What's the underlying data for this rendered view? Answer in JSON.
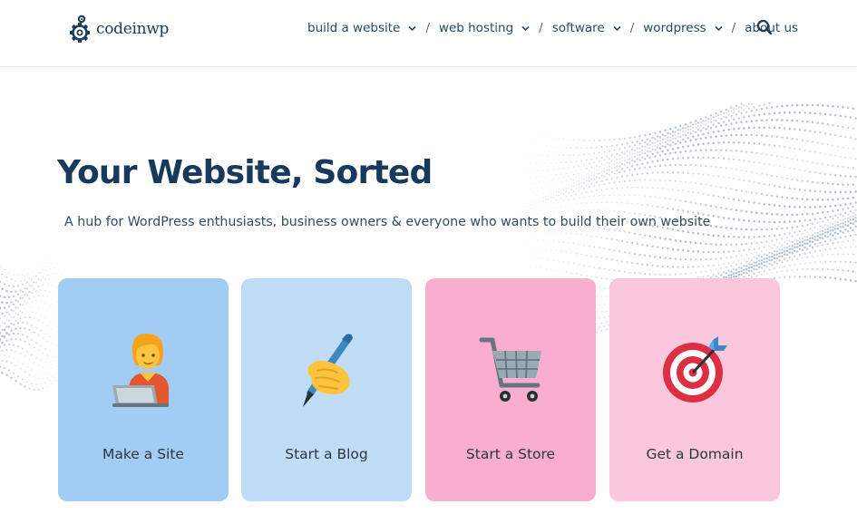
{
  "brand": {
    "name": "codeinwp"
  },
  "nav": {
    "items": [
      {
        "label": "build a website",
        "has_dropdown": true
      },
      {
        "label": "web hosting",
        "has_dropdown": true
      },
      {
        "label": "software",
        "has_dropdown": true
      },
      {
        "label": "wordpress",
        "has_dropdown": true
      },
      {
        "label": "about us",
        "has_dropdown": false
      }
    ],
    "separator": "/",
    "search_icon": "search-icon"
  },
  "hero": {
    "title": "Your Website, Sorted",
    "subtitle": "A hub for WordPress enthusiasts, business owners & everyone who wants to build their own website"
  },
  "cards": [
    {
      "label": "Make a Site",
      "icon": "technologist-icon",
      "color": "#a3ccf5"
    },
    {
      "label": "Start a Blog",
      "icon": "writing-hand-icon",
      "color": "#c0dcf7"
    },
    {
      "label": "Start a Store",
      "icon": "shopping-cart-icon",
      "color": "#f9aecf"
    },
    {
      "label": "Get a Domain",
      "icon": "direct-hit-icon",
      "color": "#fbc7dd"
    }
  ],
  "colors": {
    "title": "#173a5c",
    "nav_text": "#2a4a68",
    "dots": "#8fa6ba"
  }
}
